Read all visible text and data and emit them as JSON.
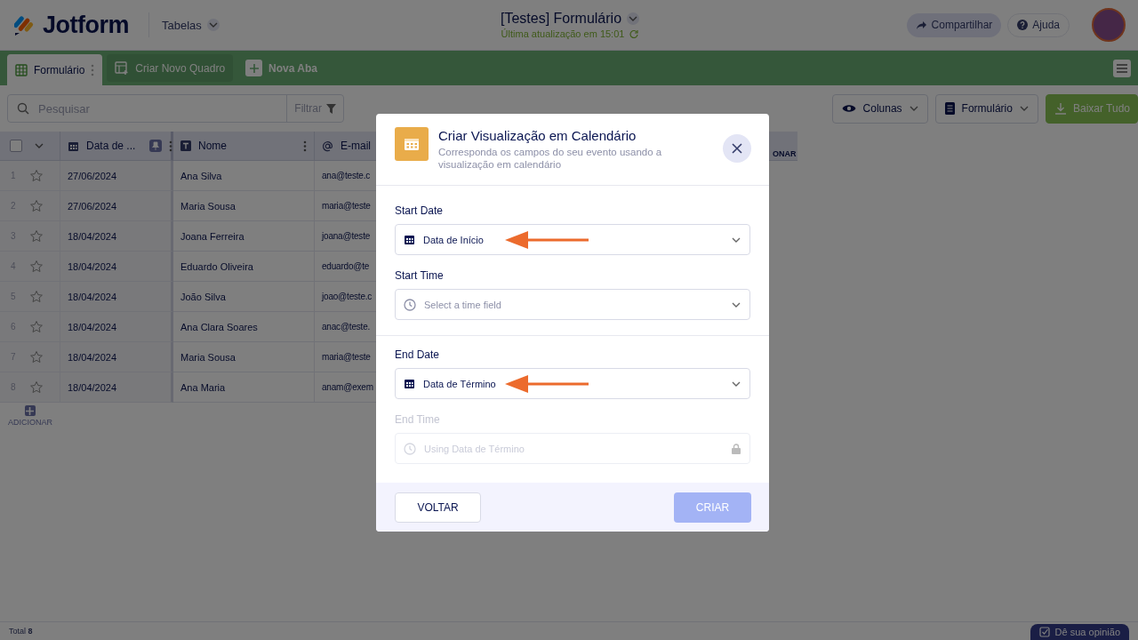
{
  "header": {
    "logo": "Jotform",
    "app_menu": "Tabelas",
    "title": "[Testes] Formulário",
    "subtitle": "Última atualização em 15:01",
    "buttons": [
      {
        "label": "Compartilhar",
        "kind": "share"
      },
      {
        "label": "Ajuda",
        "kind": "help"
      }
    ]
  },
  "tabs": [
    {
      "label": "Formulário",
      "kind": "sheet",
      "selected": true
    },
    {
      "label": "Criar Novo Quadro",
      "kind": "create",
      "selected": false
    },
    {
      "label": "Nova Aba",
      "kind": "add",
      "selected": false
    }
  ],
  "toolbar": {
    "search": {
      "placeholder": "Pesquisar"
    },
    "filter": "Filtrar",
    "buttons": [
      {
        "label": "Colunas",
        "kind": "columns"
      },
      {
        "label": "Formulário",
        "kind": "form"
      },
      {
        "label": "Baixar Tudo",
        "kind": "download"
      }
    ]
  },
  "table": {
    "select_all": {
      "checked": false
    },
    "columns": [
      {
        "label": "Data de ...",
        "kind": "date"
      },
      {
        "label": "Nome",
        "kind": "text"
      },
      {
        "label": "E-mail",
        "kind": "email"
      }
    ],
    "add_column": "ONAR",
    "rows": [
      {
        "number": "1",
        "starred": false,
        "cells": [
          "27/06/2024",
          "Ana Silva",
          "ana@teste.c"
        ]
      },
      {
        "number": "2",
        "starred": false,
        "cells": [
          "27/06/2024",
          "Maria Sousa",
          "maria@teste"
        ]
      },
      {
        "number": "3",
        "starred": false,
        "cells": [
          "18/04/2024",
          "Joana Ferreira",
          "joana@teste"
        ]
      },
      {
        "number": "4",
        "starred": false,
        "cells": [
          "18/04/2024",
          "Eduardo Oliveira",
          "eduardo@te"
        ]
      },
      {
        "number": "5",
        "starred": false,
        "cells": [
          "18/04/2024",
          "João Silva",
          "joao@teste.c"
        ]
      },
      {
        "number": "6",
        "starred": false,
        "cells": [
          "18/04/2024",
          "Ana Clara Soares",
          "anac@teste."
        ]
      },
      {
        "number": "7",
        "starred": false,
        "cells": [
          "18/04/2024",
          "Maria Sousa",
          "maria@teste"
        ]
      },
      {
        "number": "8",
        "starred": false,
        "cells": [
          "18/04/2024",
          "Ana Maria",
          "anam@exem"
        ]
      }
    ],
    "add_row": "ADICIONAR"
  },
  "footer": {
    "total": "Total **8**",
    "feedback": "Dê sua opinião"
  },
  "modal": {
    "title": "Criar Visualização em Calendário",
    "subtitle": "Corresponda os campos do seu evento usando a visualização em calendário",
    "sections": [
      {
        "fields": [
          {
            "label": "Start Date",
            "kind": "date",
            "value": "Data de Início",
            "disabled": false,
            "annotated": true
          },
          {
            "label": "Start Time",
            "kind": "time",
            "placeholder": "Select a time field",
            "disabled": false,
            "annotated": false
          }
        ]
      },
      {
        "fields": [
          {
            "label": "End Date",
            "kind": "date",
            "value": "Data de Término",
            "disabled": false,
            "annotated": true
          },
          {
            "label": "End Time",
            "kind": "time",
            "placeholder": "Using Data de Término",
            "disabled": true,
            "annotated": false
          }
        ]
      }
    ],
    "back": "VOLTAR",
    "create": {
      "label": "CRIAR",
      "disabled": true
    }
  }
}
